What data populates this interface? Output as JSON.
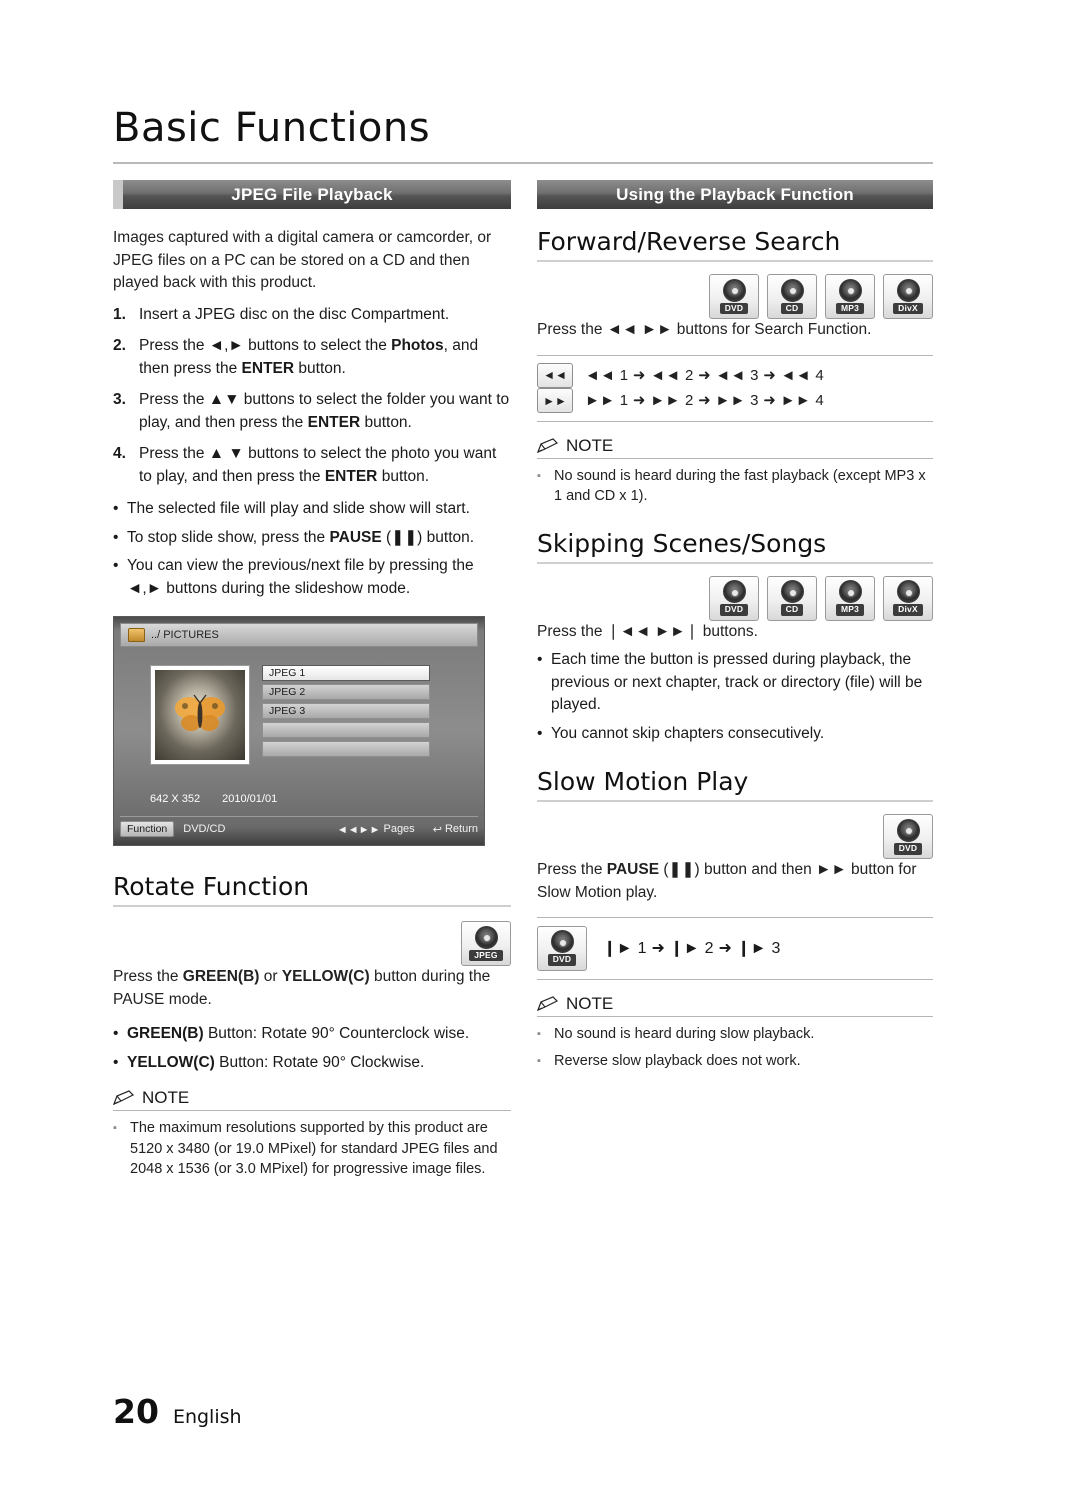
{
  "header": {
    "title": "Basic Functions"
  },
  "left": {
    "banner": "JPEG File Playback",
    "intro": "Images captured with a digital camera or camcorder, or JPEG files on a PC can be stored on a CD and then played back with this product.",
    "steps": [
      {
        "num": "1.",
        "parts": [
          {
            "t": "Insert a JPEG disc on the disc Compartment.",
            "b": false
          }
        ]
      },
      {
        "num": "2.",
        "parts": [
          {
            "t": "Press the ",
            "b": false
          },
          {
            "t": "◄,►",
            "b": false
          },
          {
            "t": " buttons to select the ",
            "b": false
          },
          {
            "t": "Photos",
            "b": true
          },
          {
            "t": ", and then press the ",
            "b": false
          },
          {
            "t": "ENTER",
            "b": true
          },
          {
            "t": " button.",
            "b": false
          }
        ]
      },
      {
        "num": "3.",
        "parts": [
          {
            "t": "Press the ",
            "b": false
          },
          {
            "t": "▲▼",
            "b": false
          },
          {
            "t": " buttons to select the folder you want to play, and then press the ",
            "b": false
          },
          {
            "t": "ENTER",
            "b": true
          },
          {
            "t": " button.",
            "b": false
          }
        ]
      },
      {
        "num": "4.",
        "parts": [
          {
            "t": "Press the ",
            "b": false
          },
          {
            "t": "▲ ▼",
            "b": false
          },
          {
            "t": " buttons to select the photo you want to play, and then press the ",
            "b": false
          },
          {
            "t": "ENTER",
            "b": true
          },
          {
            "t": " button.",
            "b": false
          }
        ]
      }
    ],
    "bullets": [
      {
        "parts": [
          {
            "t": "The selected file will play and slide show will start.",
            "b": false
          }
        ]
      },
      {
        "parts": [
          {
            "t": "To stop slide show, press the ",
            "b": false
          },
          {
            "t": "PAUSE",
            "b": true
          },
          {
            "t": " (❚❚) button.",
            "b": false
          }
        ]
      },
      {
        "parts": [
          {
            "t": "You can view the previous/next file by pressing the ",
            "b": false
          },
          {
            "t": "◄,►",
            "b": false
          },
          {
            "t": " buttons during the slideshow mode.",
            "b": false
          }
        ]
      }
    ],
    "osd": {
      "path": "../ PICTURES",
      "items": [
        "JPEG 1",
        "JPEG 2",
        "JPEG 3",
        "",
        ""
      ],
      "selected_index": 0,
      "resolution": "642 X 352",
      "date": "2010/01/01",
      "function_chip": "Function",
      "function_value": "DVD/CD",
      "pages_label": "Pages",
      "return_label": "Return"
    },
    "rotate": {
      "heading": "Rotate Function",
      "badge": {
        "icon": "disc-icon",
        "label": "JPEG"
      },
      "intro_parts": [
        {
          "t": "Press the ",
          "b": false
        },
        {
          "t": "GREEN(B)",
          "b": true
        },
        {
          "t": " or ",
          "b": false
        },
        {
          "t": "YELLOW(C)",
          "b": true
        },
        {
          "t": " button during the PAUSE mode.",
          "b": false
        }
      ],
      "bullets": [
        {
          "parts": [
            {
              "t": "GREEN(B)",
              "b": true
            },
            {
              "t": " Button: Rotate 90° Counterclock wise.",
              "b": false
            }
          ]
        },
        {
          "parts": [
            {
              "t": "YELLOW(C)",
              "b": true
            },
            {
              "t": " Button: Rotate 90° Clockwise.",
              "b": false
            }
          ]
        }
      ],
      "note_label": "NOTE",
      "notes": [
        "The maximum resolutions supported by this product are 5120 x 3480 (or 19.0 MPixel) for standard JPEG files and 2048 x 1536 (or 3.0 MPixel) for progressive image files."
      ]
    }
  },
  "right": {
    "banner": "Using the Playback Function",
    "forward": {
      "heading": "Forward/Reverse Search",
      "badges": [
        {
          "icon": "disc-icon",
          "label": "DVD"
        },
        {
          "icon": "disc-icon",
          "label": "CD"
        },
        {
          "icon": "disc-icon",
          "label": "MP3"
        },
        {
          "icon": "disc-icon",
          "label": "DivX"
        }
      ],
      "intro": "Press the ◄◄ ►► buttons for Search Function.",
      "sequences": [
        {
          "key": "◄◄",
          "text": "◄◄ 1 ➜ ◄◄ 2 ➜ ◄◄ 3 ➜ ◄◄ 4"
        },
        {
          "key": "►►",
          "text": "►► 1 ➜ ►► 2 ➜ ►► 3 ➜ ►► 4"
        }
      ],
      "note_label": "NOTE",
      "notes": [
        "No sound is heard during the fast playback (except MP3 x 1 and CD x 1)."
      ]
    },
    "skipping": {
      "heading": "Skipping Scenes/Songs",
      "badges": [
        {
          "icon": "disc-icon",
          "label": "DVD"
        },
        {
          "icon": "disc-icon",
          "label": "CD"
        },
        {
          "icon": "disc-icon",
          "label": "MP3"
        },
        {
          "icon": "disc-icon",
          "label": "DivX"
        }
      ],
      "intro": "Press the ❘◄◄ ►►❘ buttons.",
      "bullets": [
        "Each time the button is pressed during playback, the previous or next chapter, track or directory (file) will be played.",
        "You cannot skip chapters consecutively."
      ]
    },
    "slow": {
      "heading": "Slow Motion Play",
      "badges": [
        {
          "icon": "disc-icon",
          "label": "DVD"
        }
      ],
      "intro_parts": [
        {
          "t": "Press the ",
          "b": false
        },
        {
          "t": "PAUSE",
          "b": true
        },
        {
          "t": " (❚❚) button and then ►► button for Slow Motion play.",
          "b": false
        }
      ],
      "sequence": {
        "badge": {
          "icon": "disc-icon",
          "label": "DVD"
        },
        "text": "❙► 1 ➜ ❙► 2 ➜ ❙► 3"
      },
      "note_label": "NOTE",
      "notes": [
        "No sound is heard during slow playback.",
        "Reverse slow playback does not work."
      ]
    }
  },
  "footer": {
    "page_number": "20",
    "language": "English"
  }
}
